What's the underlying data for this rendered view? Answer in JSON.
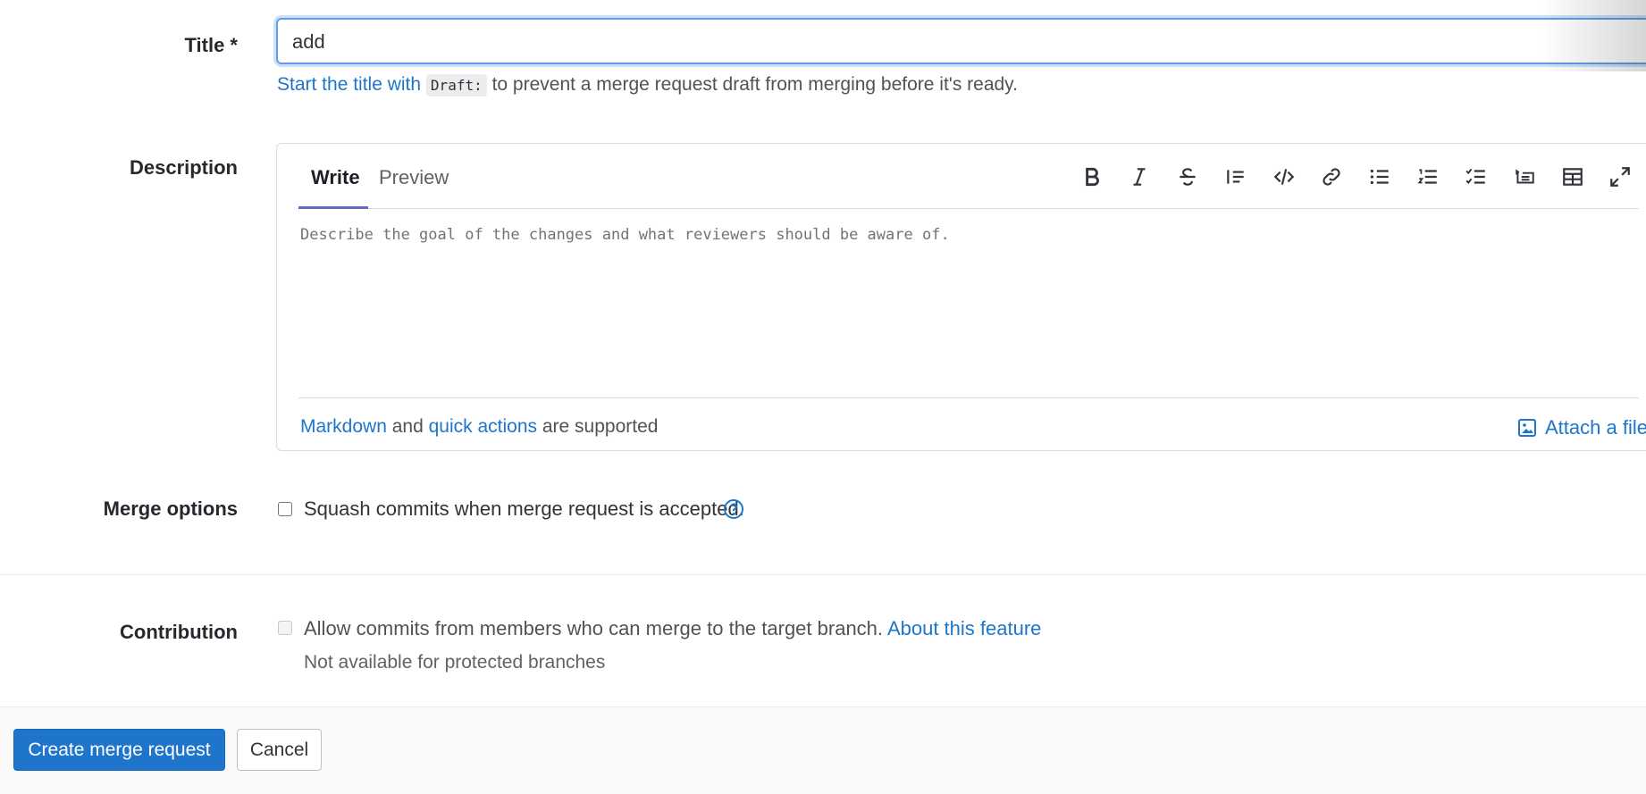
{
  "title_field": {
    "label": "Title *",
    "value": "add",
    "hint_link": "Start the title with",
    "hint_code": "Draft:",
    "hint_rest": "to prevent a merge request draft from merging before it's ready."
  },
  "description": {
    "label": "Description",
    "tabs": [
      {
        "label": "Write",
        "active": true
      },
      {
        "label": "Preview",
        "active": false
      }
    ],
    "toolbar_icons": [
      "bold-icon",
      "italic-icon",
      "strikethrough-icon",
      "quote-icon",
      "code-icon",
      "link-icon",
      "bulleted-list-icon",
      "numbered-list-icon",
      "task-list-icon",
      "collapsible-section-icon",
      "table-icon",
      "fullscreen-icon"
    ],
    "placeholder": "Describe the goal of the changes and what reviewers should be aware of.",
    "footer": {
      "markdown_link": "Markdown",
      "and_text": "and",
      "quick_actions_link": "quick actions",
      "supported_text": "are supported",
      "attach_label": "Attach a file"
    }
  },
  "merge_options": {
    "label": "Merge options",
    "squash_label": "Squash commits when merge request is accepted.",
    "squash_checked": false
  },
  "contribution": {
    "label": "Contribution",
    "allow_label": "Allow commits from members who can merge to the target branch.",
    "about_link": "About this feature",
    "note": "Not available for protected branches"
  },
  "actions": {
    "create_label": "Create merge request",
    "cancel_label": "Cancel"
  },
  "colors": {
    "accent": "#1f75cb",
    "tab_underline": "#6666c4"
  }
}
